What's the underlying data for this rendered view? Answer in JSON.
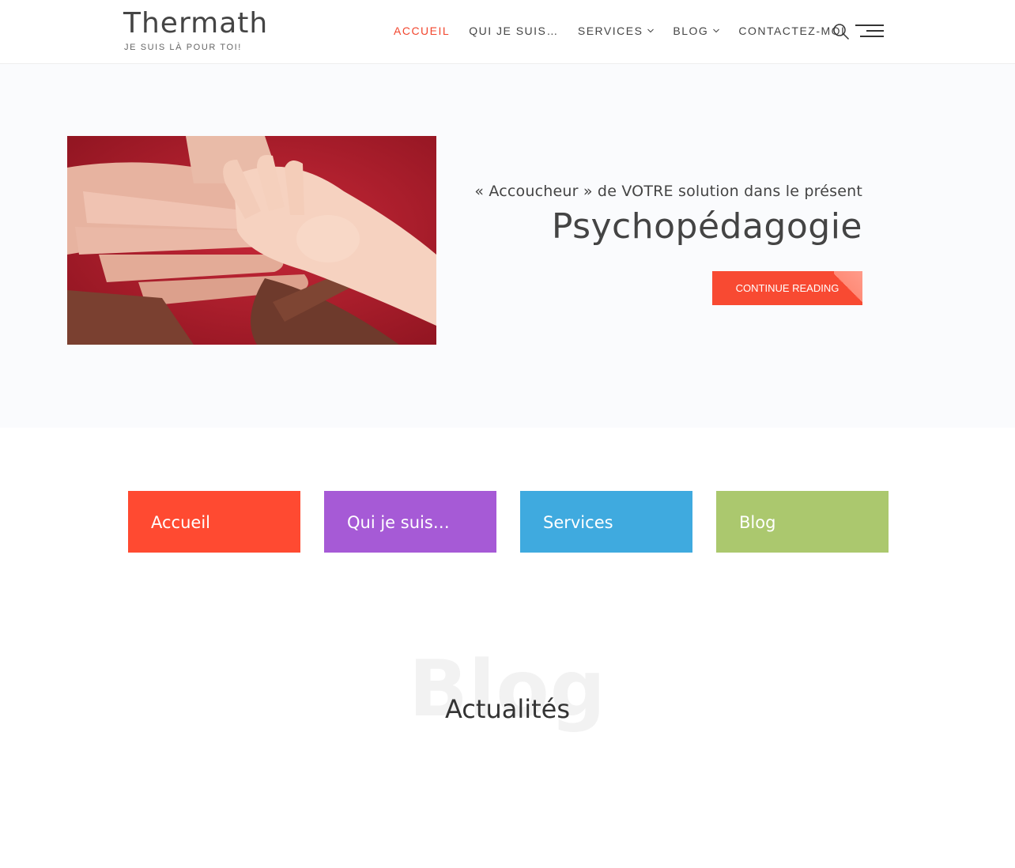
{
  "header": {
    "site_title": "Thermath",
    "tagline": "JE SUIS LÀ POUR TOI!",
    "nav": [
      {
        "label": "ACCUEIL",
        "active": true,
        "dropdown": false
      },
      {
        "label": "QUI JE SUIS…",
        "active": false,
        "dropdown": false
      },
      {
        "label": "SERVICES",
        "active": false,
        "dropdown": true
      },
      {
        "label": "BLOG",
        "active": false,
        "dropdown": true
      },
      {
        "label": "CONTACTEZ-MOI",
        "active": false,
        "dropdown": false
      }
    ],
    "icons": {
      "search": "search-icon",
      "menu": "hamburger-menu-icon",
      "dropdown": "chevron-down-icon"
    }
  },
  "hero": {
    "subtitle": "« Accoucheur » de VOTRE solution dans le présent",
    "title": "Psychopédagogie",
    "button_label": "CONTINUE READING"
  },
  "features": [
    {
      "label": "Accueil",
      "color": "#ff4a31"
    },
    {
      "label": "Qui je suis…",
      "color": "#a65ad6"
    },
    {
      "label": "Services",
      "color": "#3faadf"
    },
    {
      "label": "Blog",
      "color": "#abc86e"
    }
  ],
  "blog": {
    "watermark": "Blog",
    "title": "Actualités"
  },
  "colors": {
    "accent": "#f2462e",
    "button": "#f84a32"
  }
}
